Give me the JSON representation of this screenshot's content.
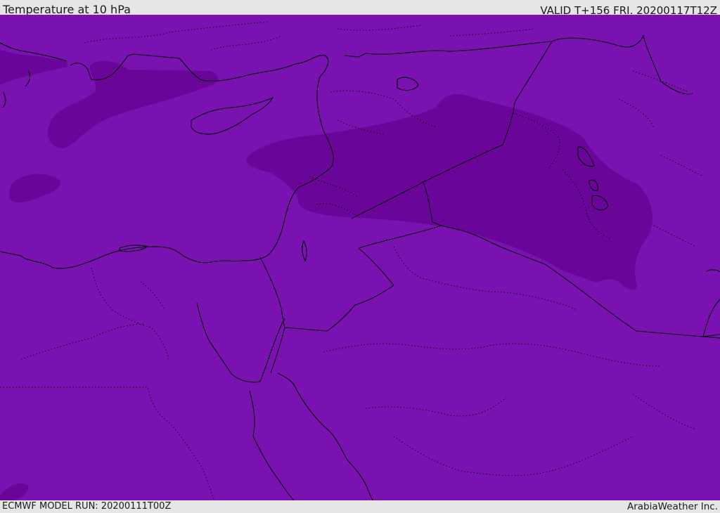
{
  "header": {
    "title": "Temperature at 10 hPa",
    "valid": "VALID T+156 FRI. 20200117T12Z"
  },
  "footer": {
    "model_run": "ECMWF MODEL RUN: 20200111T00Z",
    "credit": "ArabiaWeather Inc."
  },
  "map": {
    "variable": "Temperature",
    "level": "10 hPa",
    "colors": {
      "background_field": "#7a12b2",
      "colder_band": "#6a0599",
      "coastline": "#000000",
      "borders_dotted": "#000000"
    }
  }
}
